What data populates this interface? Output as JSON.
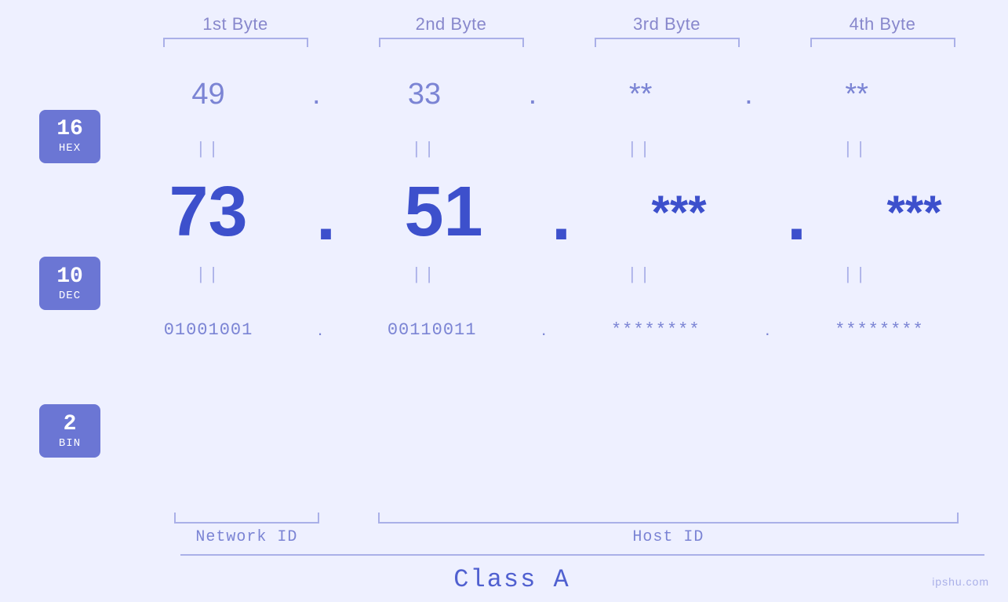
{
  "header": {
    "byte1": "1st Byte",
    "byte2": "2nd Byte",
    "byte3": "3rd Byte",
    "byte4": "4th Byte"
  },
  "labels": {
    "hex_num": "16",
    "hex_base": "HEX",
    "dec_num": "10",
    "dec_base": "DEC",
    "bin_num": "2",
    "bin_base": "BIN"
  },
  "hex_values": {
    "b1": "49",
    "b2": "33",
    "b3": "**",
    "b4": "**"
  },
  "dec_values": {
    "b1": "73",
    "b2": "51",
    "b3": "***",
    "b4": "***"
  },
  "bin_values": {
    "b1": "01001001",
    "b2": "00110011",
    "b3": "********",
    "b4": "********"
  },
  "equals": "||",
  "bottom": {
    "network_id": "Network ID",
    "host_id": "Host ID",
    "class": "Class A"
  },
  "watermark": "ipshu.com"
}
